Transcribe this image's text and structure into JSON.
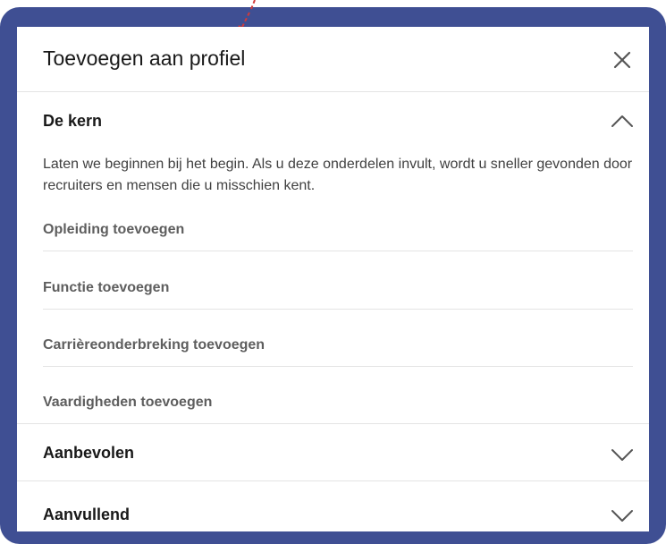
{
  "dialog": {
    "title": "Toevoegen aan profiel",
    "close_icon": "close-icon"
  },
  "sections": [
    {
      "title": "De kern",
      "expanded": true,
      "description": "Laten we beginnen bij het begin. Als u deze onderdelen invult, wordt u sneller gevonden door recruiters en mensen die u misschien kent.",
      "items": [
        "Opleiding toevoegen",
        "Functie toevoegen",
        "Carrièreonderbreking toevoegen",
        "Vaardigheden toevoegen"
      ]
    },
    {
      "title": "Aanbevolen",
      "expanded": false
    },
    {
      "title": "Aanvullend",
      "expanded": false
    }
  ],
  "colors": {
    "frame": "#3f4f93",
    "annotation_arrow": "#d23a3a",
    "item_text": "#5e5e5e",
    "title_text": "#191919",
    "divider": "#e4e4e4"
  }
}
